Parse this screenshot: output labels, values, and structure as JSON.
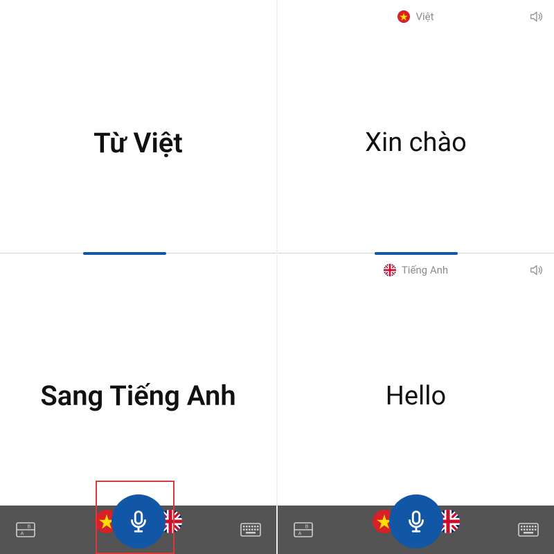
{
  "left": {
    "top": {
      "flag_name": "vietnam-flag-icon",
      "text": "Từ Việt"
    },
    "bottom": {
      "text": "Sang Tiếng Anh"
    }
  },
  "right": {
    "top": {
      "lang_label": "Việt",
      "flag_name": "vietnam-flag-icon",
      "text": "Xin chào"
    },
    "bottom": {
      "lang_label": "Tiếng Anh",
      "flag_name": "uk-flag-icon",
      "text": "Hello"
    }
  },
  "colors": {
    "accent": "#1157a6",
    "bottom_bar": "#545454",
    "highlight": "#d63b3b"
  }
}
